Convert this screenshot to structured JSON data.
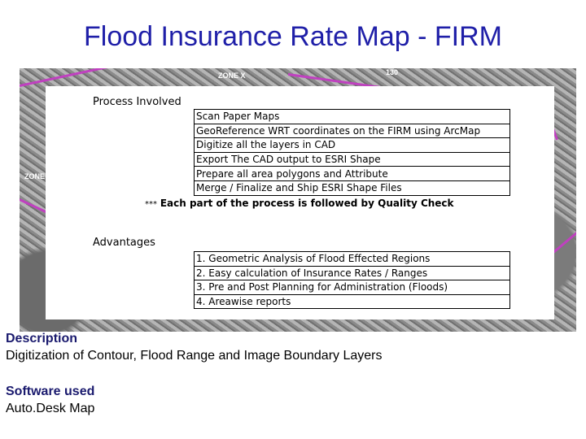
{
  "title": "Flood Insurance Rate Map - FIRM",
  "map": {
    "labels": [
      "ZONE X",
      "ZONE X",
      "130"
    ]
  },
  "process": {
    "heading": "Process Involved",
    "steps": [
      "Scan Paper Maps",
      "GeoReference WRT coordinates on the FIRM using ArcMap",
      "Digitize all the layers in CAD",
      "Export The CAD output to ESRI Shape",
      "Prepare all area polygons and Attribute",
      "Merge / Finalize and Ship ESRI Shape Files"
    ],
    "note_prefix": "***",
    "note": "Each part of the process is followed by Quality Check"
  },
  "advantages": {
    "heading": "Advantages",
    "items": [
      "1. Geometric Analysis of Flood Effected Regions",
      "2. Easy calculation of Insurance Rates / Ranges",
      "3. Pre and Post Planning for Administration (Floods)",
      "4. Areawise reports"
    ]
  },
  "description": {
    "heading": "Description",
    "text": "Digitization of Contour, Flood Range and Image Boundary Layers"
  },
  "software": {
    "heading": "Software used",
    "text": "Auto.Desk Map"
  }
}
